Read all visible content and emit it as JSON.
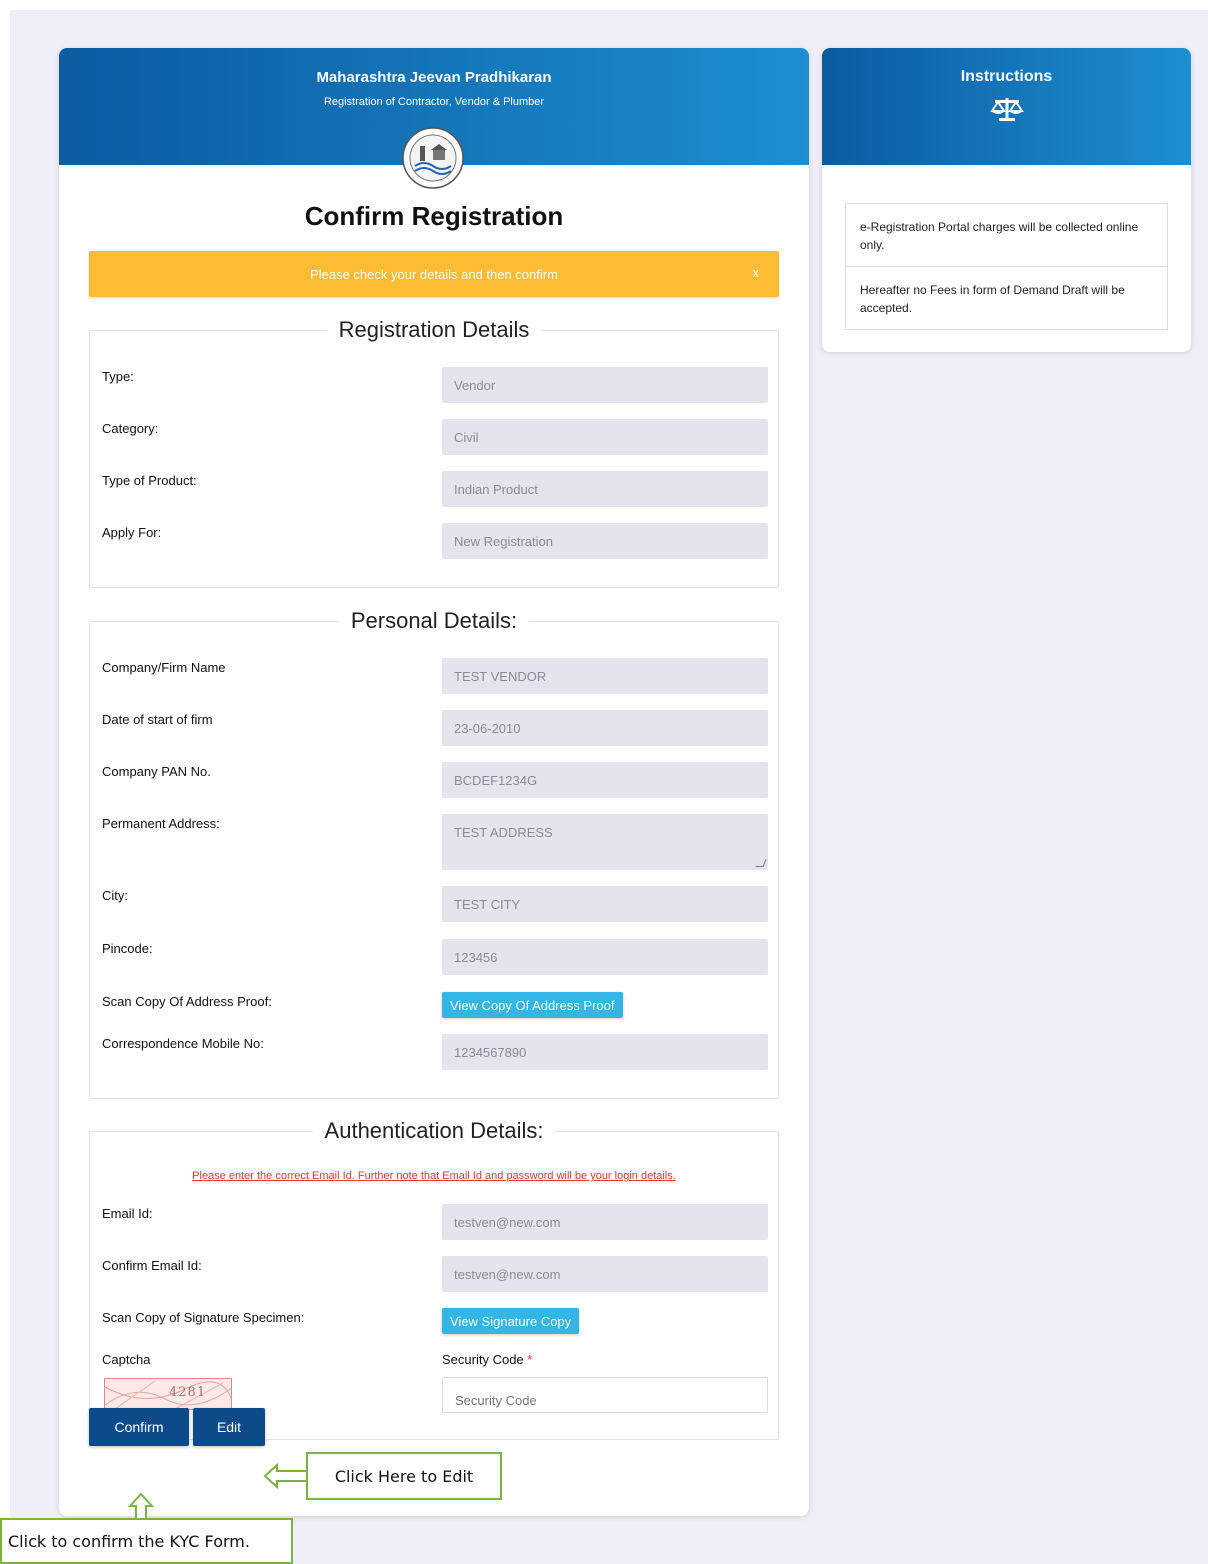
{
  "header": {
    "title": "Maharashtra Jeevan Pradhikaran",
    "subtitle": "Registration of Contractor, Vendor & Plumber",
    "logo_text": "Maharashtra Jeevan Pradhikaran"
  },
  "page_title": "Confirm Registration",
  "alert": {
    "message": "Please check your details and then confirm",
    "close": "x"
  },
  "registration": {
    "legend": "Registration Details",
    "rows": [
      {
        "label": "Type:",
        "value": "Vendor"
      },
      {
        "label": "Category:",
        "value": "Civil"
      },
      {
        "label": "Type of Product:",
        "value": "Indian Product"
      },
      {
        "label": "Apply For:",
        "value": "New Registration"
      }
    ]
  },
  "personal": {
    "legend": "Personal Details:",
    "company_label": "Company/Firm Name",
    "company": "TEST VENDOR",
    "date_label": "Date of start of firm",
    "date": "23-06-2010",
    "pan_label": "Company PAN No.",
    "pan": "BCDEF1234G",
    "address_label": "Permanent Address:",
    "address": "TEST ADDRESS",
    "city_label": "City:",
    "city": "TEST CITY",
    "pincode_label": "Pincode:",
    "pincode": "123456",
    "proof_label": "Scan Copy Of Address Proof:",
    "proof_button": "View Copy Of Address Proof",
    "mobile_label": "Correspondence Mobile No:",
    "mobile": "1234567890"
  },
  "auth": {
    "legend": "Authentication Details:",
    "note": "Please enter the correct Email Id. Further note that Email Id and password will be your login details.",
    "email_label": "Email Id:",
    "email": "testven@new.com",
    "confirm_email_label": "Confirm Email Id:",
    "confirm_email": "testven@new.com",
    "signature_label": "Scan Copy of Signature Specimen:",
    "signature_button": "View Signature Copy",
    "captcha_label": "Captcha",
    "captcha_text": "4281",
    "security_label": "Security Code",
    "security_required": "*",
    "security_placeholder": "Security Code"
  },
  "actions": {
    "confirm": "Confirm",
    "edit": "Edit"
  },
  "instructions": {
    "title": "Instructions",
    "icon": "balance-scale-icon",
    "items": [
      "e-Registration Portal charges will be collected online only.",
      "Hereafter no Fees in form of Demand Draft will be accepted."
    ]
  },
  "callouts": {
    "edit_hint": "Click Here to Edit",
    "confirm_hint": "Click to confirm the KYC Form."
  },
  "colors": {
    "header_start": "#0c5ba1",
    "header_end": "#1c8fd0",
    "alert": "#ffbb33",
    "info_button": "#33b5e5",
    "primary_button": "#0d4a8a",
    "callout_border": "#7cb342",
    "note_red": "#e53935"
  }
}
